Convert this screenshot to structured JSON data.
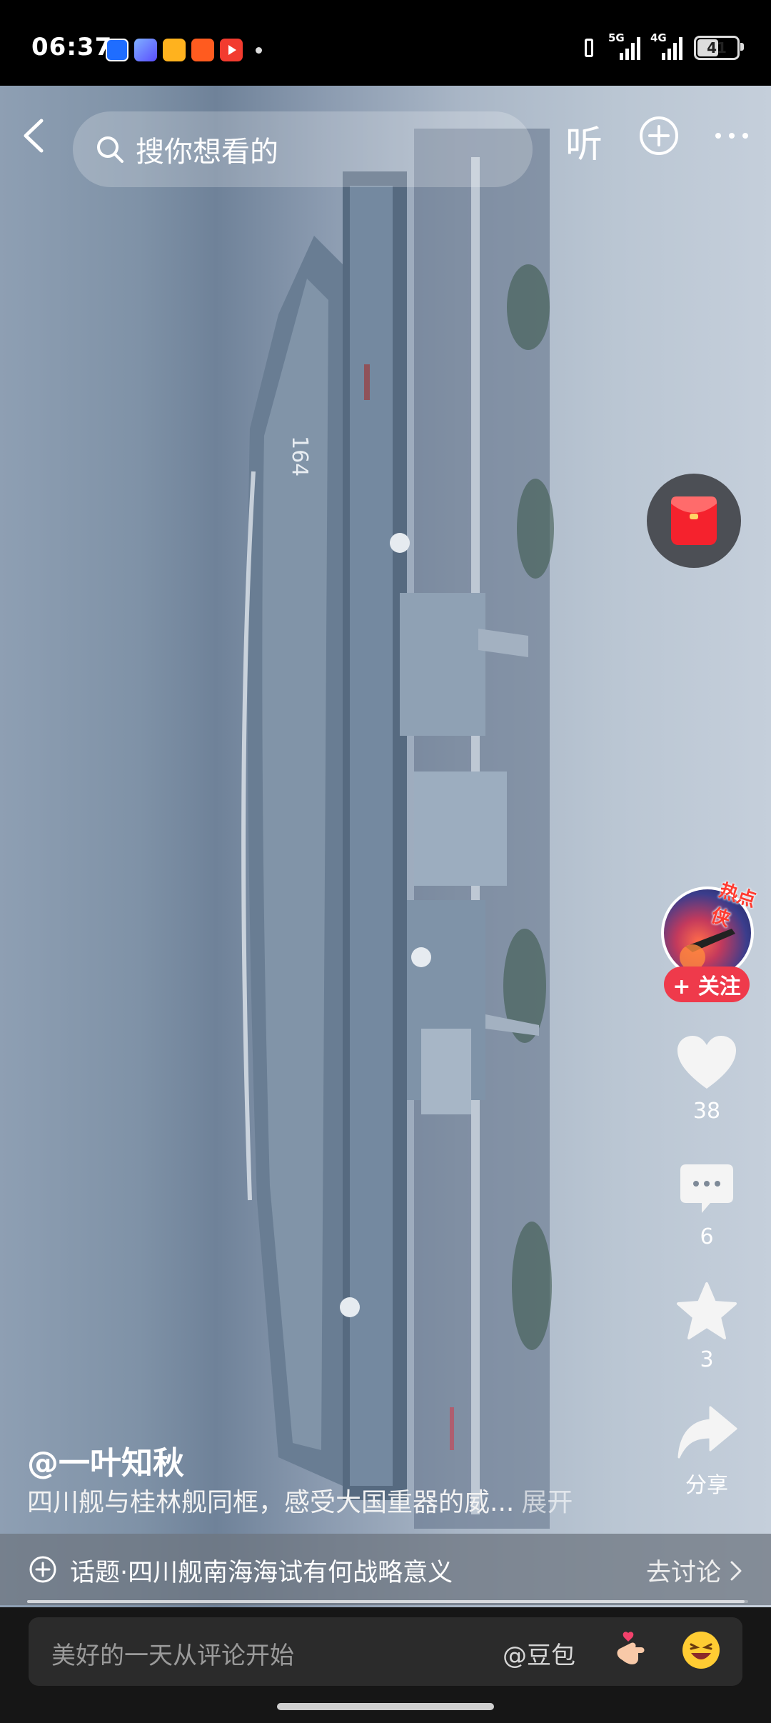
{
  "status_bar": {
    "time": "06:37",
    "notification_icons": [
      "quark-icon",
      "ai-app-icon",
      "video-app-icon",
      "taobao-icon",
      "play-icon"
    ],
    "signal_1_label": "5G",
    "signal_2_label": "4G",
    "battery": "41"
  },
  "top_bar": {
    "search_placeholder": "搜你想看的",
    "listen_label": "听"
  },
  "video": {
    "hull_number": "164"
  },
  "author": {
    "handle": "@一叶知秋",
    "hot_tag": "热点侠",
    "follow_label": "+ 关注"
  },
  "actions": {
    "likes": "38",
    "comments": "6",
    "favorites": "3",
    "share_label": "分享"
  },
  "caption": {
    "text": "四川舰与桂林舰同框，感受大国重器的威...",
    "expand_label": "展开"
  },
  "topic": {
    "text": "话题·四川舰南海海试有何战略意义",
    "discuss_label": "去讨论"
  },
  "playback": {
    "progress_fraction": 0.995
  },
  "comment_bar": {
    "placeholder": "美好的一天从评论开始",
    "mention": "@豆包"
  }
}
